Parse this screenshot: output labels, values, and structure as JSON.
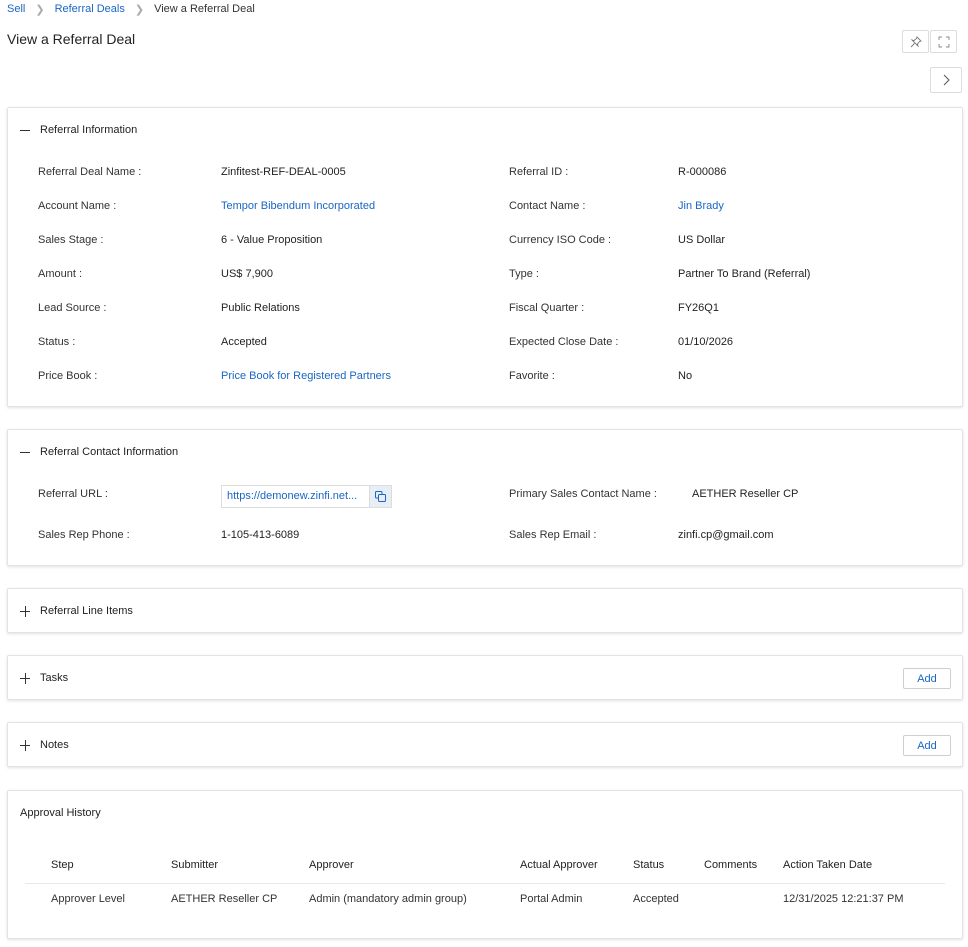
{
  "breadcrumb": {
    "items": [
      "Sell",
      "Referral Deals",
      "View a Referral Deal"
    ]
  },
  "page_title": "View a Referral Deal",
  "icons": {
    "pin": "pin-icon",
    "expand": "fullscreen-icon",
    "next": "chevron-right-icon"
  },
  "colors": {
    "link": "#1a66c4",
    "border": "#e3e3e3"
  },
  "referral_info": {
    "title": "Referral Information",
    "fields": [
      {
        "label": "Referral Deal Name :",
        "value": "Zinfitest-REF-DEAL-0005"
      },
      {
        "label": "Referral ID :",
        "value": "R-000086"
      },
      {
        "label": "Account Name :",
        "value": "Tempor Bibendum Incorporated"
      },
      {
        "label": "Contact Name :",
        "value": "Jin Brady"
      },
      {
        "label": "Sales Stage :",
        "value": "6 - Value Proposition"
      },
      {
        "label": "Currency ISO Code :",
        "value": "US Dollar"
      },
      {
        "label": "Amount :",
        "value": "US$ 7,900"
      },
      {
        "label": "Type :",
        "value": "Partner To Brand (Referral)"
      },
      {
        "label": "Lead Source :",
        "value": "Public Relations"
      },
      {
        "label": "Fiscal Quarter :",
        "value": "FY26Q1"
      },
      {
        "label": "Status :",
        "value": "Accepted"
      },
      {
        "label": "Expected Close Date :",
        "value": "01/10/2026"
      },
      {
        "label": "Price Book :",
        "value": "Price Book for Registered Partners"
      },
      {
        "label": "Favorite :",
        "value": "No"
      }
    ]
  },
  "contact_info": {
    "title": "Referral Contact Information",
    "fields": [
      {
        "label": "Referral URL :",
        "value": "https://demonew.zinfi.net..."
      },
      {
        "label": "Primary Sales Contact Name :",
        "value": "AETHER Reseller CP"
      },
      {
        "label": "Sales Rep Phone :",
        "value": "1-105-413-6089"
      },
      {
        "label": "Sales Rep Email :",
        "value": "zinfi.cp@gmail.com"
      }
    ]
  },
  "line_items": {
    "title": "Referral Line Items"
  },
  "tasks": {
    "title": "Tasks",
    "add_label": "Add"
  },
  "notes": {
    "title": "Notes",
    "add_label": "Add"
  },
  "approval_history": {
    "title": "Approval History",
    "columns": [
      "Step",
      "Submitter",
      "Approver",
      "Actual Approver",
      "Status",
      "Comments",
      "Action Taken Date"
    ],
    "rows": [
      [
        "Approver Level",
        "AETHER Reseller CP",
        "Admin (mandatory admin group)",
        "Portal Admin",
        "Accepted",
        "",
        "12/31/2025 12:21:37 PM"
      ]
    ]
  }
}
